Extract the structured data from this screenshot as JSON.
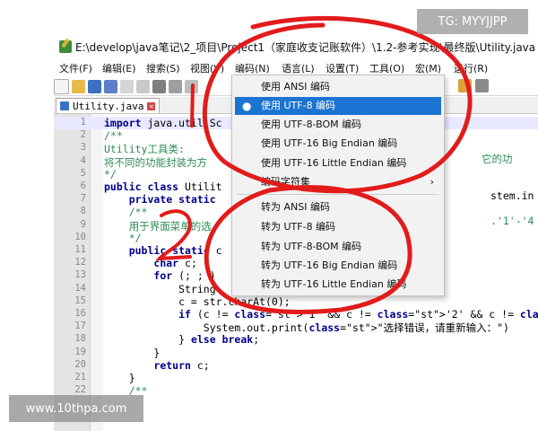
{
  "window": {
    "title": "E:\\develop\\java笔记\\2_项目\\Project1（家庭收支记账软件）\\1.2-参考实现\\最终版\\Utility.java"
  },
  "menu": [
    "文件(F)",
    "编辑(E)",
    "搜索(S)",
    "视图(V)",
    "编码(N)",
    "语言(L)",
    "设置(T)",
    "工具(O)",
    "宏(M)",
    "运行(R)"
  ],
  "tab": {
    "label": "Utility.java",
    "close": "✕"
  },
  "editor": {
    "lines": [
      {
        "n": "1",
        "code": "import java.util.Sc"
      },
      {
        "n": "2",
        "code": "/**"
      },
      {
        "n": "3",
        "code": "Utility工具类:"
      },
      {
        "n": "4",
        "code": "将不同的功能封装为方"
      },
      {
        "n": "5",
        "code": "*/"
      },
      {
        "n": "6",
        "code": "public class Utilit"
      },
      {
        "n": "7",
        "code": "    private static"
      },
      {
        "n": "8",
        "code": "    /**"
      },
      {
        "n": "9",
        "code": "    用于界面菜单的选"
      },
      {
        "n": "10",
        "code": "    */"
      },
      {
        "n": "11",
        "code": "    public static c"
      },
      {
        "n": "12",
        "code": "        char c;"
      },
      {
        "n": "13",
        "code": "        for (; ; )"
      },
      {
        "n": "14",
        "code": "            String"
      },
      {
        "n": "15",
        "code": "            c = str.charAt(0);"
      },
      {
        "n": "16",
        "code": "            if (c != '1' && c != '2' && c != '3' && c != '"
      },
      {
        "n": "17",
        "code": "                System.out.print(\"选择错误，请重新输入：\")"
      },
      {
        "n": "18",
        "code": "            } else break;"
      },
      {
        "n": "19",
        "code": "        }"
      },
      {
        "n": "20",
        "code": "        return c;"
      },
      {
        "n": "21",
        "code": "    }"
      },
      {
        "n": "22",
        "code": "    /**"
      }
    ],
    "right_fragments": {
      "line1": "",
      "line4": "它的功",
      "line7": "stem.in",
      "line9": ".'1'-'4"
    }
  },
  "encoding_menu": {
    "items": [
      {
        "label": "使用 ANSI 编码",
        "selected": false
      },
      {
        "label": "使用 UTF-8 编码",
        "selected": true
      },
      {
        "label": "使用 UTF-8-BOM 编码",
        "selected": false
      },
      {
        "label": "使用 UTF-16 Big Endian 编码",
        "selected": false
      },
      {
        "label": "使用 UTF-16 Little Endian 编码",
        "selected": false
      },
      {
        "label": "编码字符集",
        "selected": false,
        "submenu": true
      },
      {
        "label": "转为 ANSI 编码",
        "selected": false
      },
      {
        "label": "转为 UTF-8 编码",
        "selected": false
      },
      {
        "label": "转为 UTF-8-BOM 编码",
        "selected": false
      },
      {
        "label": "转为 UTF-16 Big Endian 编码",
        "selected": false
      },
      {
        "label": "转为 UTF-16 Little Endian 编码",
        "selected": false
      }
    ],
    "bullet": "●",
    "submenu_arrow": "›"
  },
  "watermarks": {
    "top": "TG: MYYJJPP",
    "bottom": "www.10thpa.com"
  },
  "colors": {
    "selection": "#1b74d1",
    "annotation": "#e21b1b",
    "keyword": "#00008a",
    "comment": "#2e8b57"
  }
}
